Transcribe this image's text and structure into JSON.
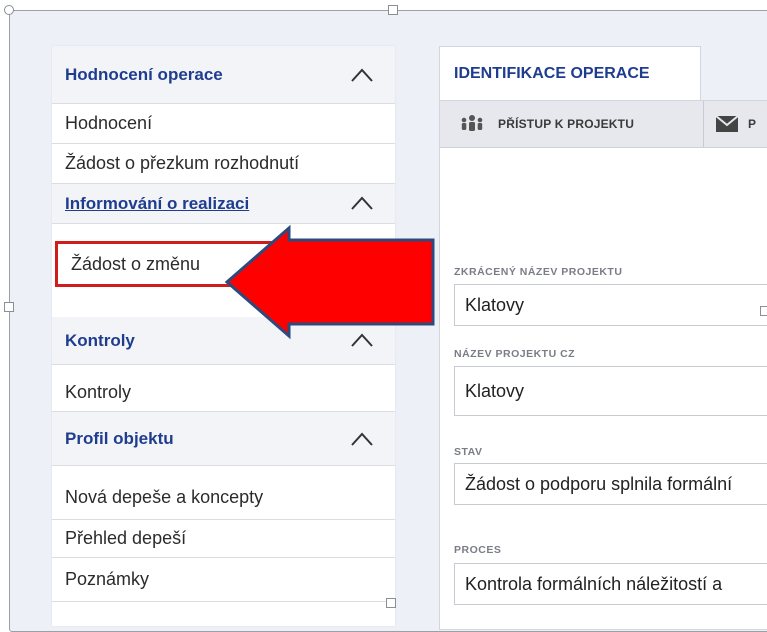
{
  "nav": {
    "items": [
      {
        "label": "Hodnocení operace",
        "type": "section"
      },
      {
        "label": "Hodnocení",
        "type": "item"
      },
      {
        "label": "Žádost o přezkum rozhodnutí",
        "type": "item"
      },
      {
        "label": "Informování o realizaci",
        "type": "section"
      },
      {
        "label": "Žádost o změnu",
        "type": "item"
      },
      {
        "label": "Kontroly",
        "type": "section"
      },
      {
        "label": "Kontroly",
        "type": "item"
      },
      {
        "label": "Profil objektu",
        "type": "section"
      },
      {
        "label": "Nová depeše a koncepty",
        "type": "item"
      },
      {
        "label": "Přehled depeší",
        "type": "item"
      },
      {
        "label": "Poznámky",
        "type": "item"
      }
    ]
  },
  "tab": {
    "label": "IDENTIFIKACE OPERACE"
  },
  "toolbar": {
    "access_label": "PŘÍSTUP K PROJEKTU",
    "mail_label": "P"
  },
  "fields": {
    "short_name": {
      "label": "ZKRÁCENÝ NÁZEV PROJEKTU",
      "value": "Klatovy"
    },
    "name_cz": {
      "label": "NÁZEV PROJEKTU CZ",
      "value": "Klatovy"
    },
    "stav": {
      "label": "STAV",
      "value": "Žádost o podporu splnila formální"
    },
    "proces": {
      "label": "PROCES",
      "value": "Kontrola formálních náležitostí a"
    }
  },
  "colors": {
    "section_text": "#1f3d8f",
    "highlight": "#d11c1c",
    "arrow_fill": "#ff0000",
    "arrow_stroke": "#2e4a7d"
  }
}
